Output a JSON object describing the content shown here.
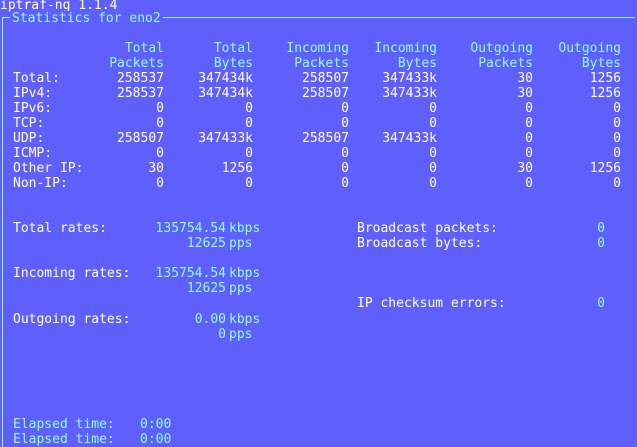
{
  "app_title": "iptraf-ng 1.1.4",
  "panel_title": "Statistics for eno2",
  "table": {
    "headers": [
      [
        "Total",
        "Packets"
      ],
      [
        "Total",
        "Bytes"
      ],
      [
        "Incoming",
        "Packets"
      ],
      [
        "Incoming",
        "Bytes"
      ],
      [
        "Outgoing",
        "Packets"
      ],
      [
        "Outgoing",
        "Bytes"
      ]
    ],
    "rows": [
      {
        "label": "Total:",
        "values": [
          "258537",
          "347434k",
          "258507",
          "347433k",
          "30",
          "1256"
        ]
      },
      {
        "label": "IPv4:",
        "values": [
          "258537",
          "347434k",
          "258507",
          "347433k",
          "30",
          "1256"
        ]
      },
      {
        "label": "IPv6:",
        "values": [
          "0",
          "0",
          "0",
          "0",
          "0",
          "0"
        ]
      },
      {
        "label": "TCP:",
        "values": [
          "0",
          "0",
          "0",
          "0",
          "0",
          "0"
        ]
      },
      {
        "label": "UDP:",
        "values": [
          "258507",
          "347433k",
          "258507",
          "347433k",
          "0",
          "0"
        ]
      },
      {
        "label": "ICMP:",
        "values": [
          "0",
          "0",
          "0",
          "0",
          "0",
          "0"
        ]
      },
      {
        "label": "Other IP:",
        "values": [
          "30",
          "1256",
          "0",
          "0",
          "30",
          "1256"
        ]
      },
      {
        "label": "Non-IP:",
        "values": [
          "0",
          "0",
          "0",
          "0",
          "0",
          "0"
        ]
      }
    ]
  },
  "rates": {
    "total_label": "Total rates:",
    "total_kbps": "135754.54",
    "total_kbps_unit": "kbps",
    "total_pps": "12625",
    "total_pps_unit": "pps",
    "incoming_label": "Incoming rates:",
    "incoming_kbps": "135754.54",
    "incoming_kbps_unit": "kbps",
    "incoming_pps": "12625",
    "incoming_pps_unit": "pps",
    "outgoing_label": "Outgoing rates:",
    "outgoing_kbps": "0.00",
    "outgoing_kbps_unit": "kbps",
    "outgoing_pps": "0",
    "outgoing_pps_unit": "pps"
  },
  "counters": {
    "broadcast_packets_label": "Broadcast packets:",
    "broadcast_packets_value": "0",
    "broadcast_bytes_label": "Broadcast bytes:",
    "broadcast_bytes_value": "0",
    "ip_checksum_errors_label": "IP checksum errors:",
    "ip_checksum_errors_value": "0"
  },
  "elapsed": {
    "label_1": "Elapsed time:",
    "value_1": "0:00",
    "label_2": "Elapsed time:",
    "value_2": "0:00"
  }
}
